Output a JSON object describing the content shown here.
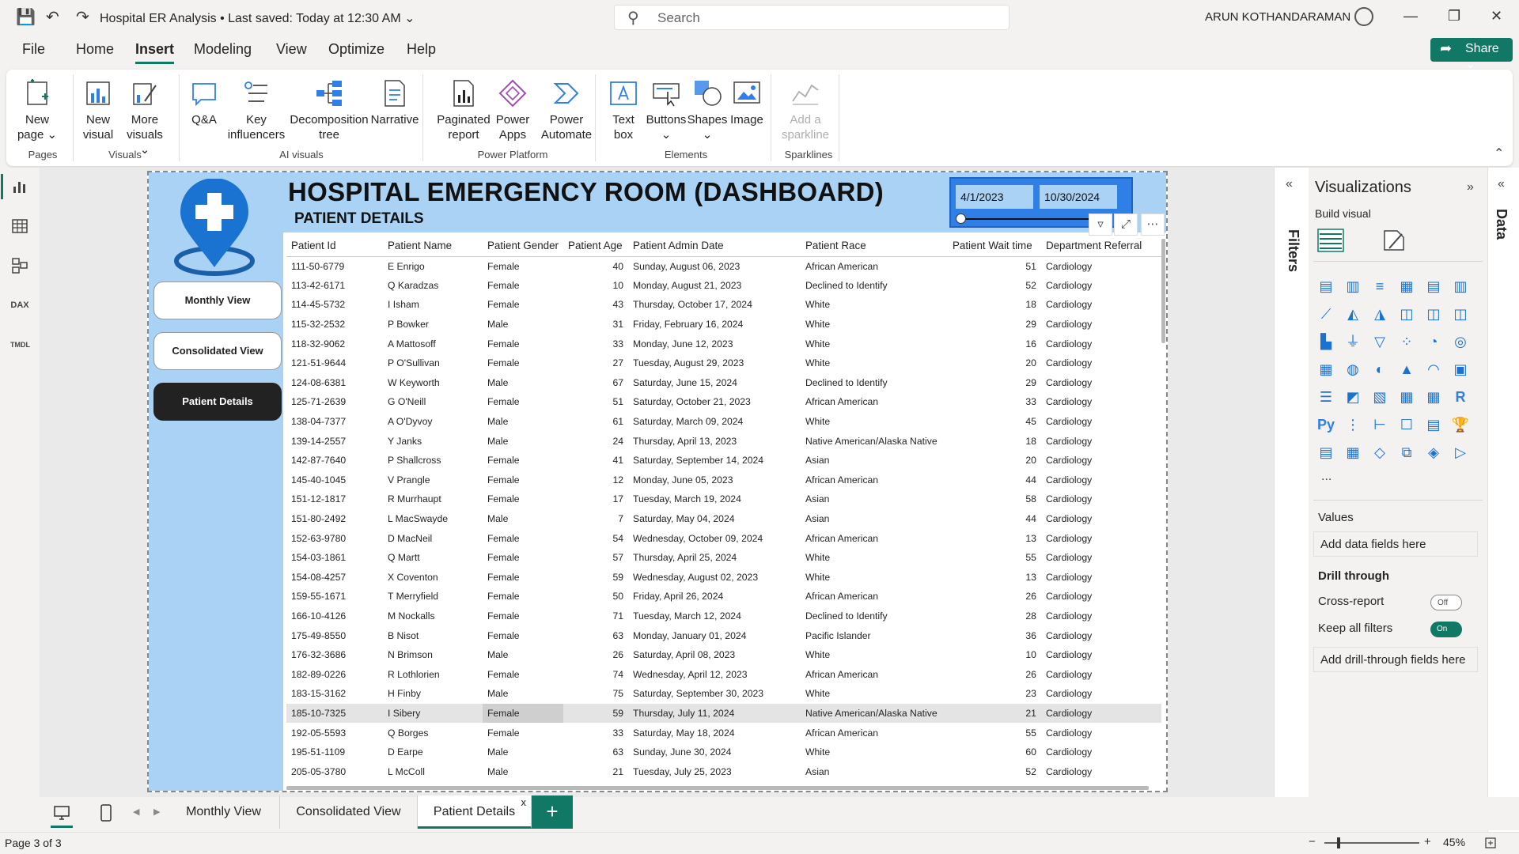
{
  "app": {
    "doc_title": "Hospital ER Analysis",
    "save_status": "Last saved: Today at 12:30 AM",
    "search_placeholder": "Search",
    "user_name": "ARUN KOTHANDARAMAN"
  },
  "menu": [
    "File",
    "Home",
    "Insert",
    "Modeling",
    "View",
    "Optimize",
    "Help"
  ],
  "share_label": "Share",
  "ribbon": {
    "buttons": [
      {
        "l1": "New",
        "l2": "page ⌄"
      },
      {
        "l1": "New",
        "l2": "visual"
      },
      {
        "l1": "More",
        "l2": "visuals ⌄"
      },
      {
        "l1": "Q&A",
        "l2": ""
      },
      {
        "l1": "Key",
        "l2": "influencers"
      },
      {
        "l1": "Decomposition",
        "l2": "tree"
      },
      {
        "l1": "Narrative",
        "l2": ""
      },
      {
        "l1": "Paginated",
        "l2": "report"
      },
      {
        "l1": "Power",
        "l2": "Apps"
      },
      {
        "l1": "Power",
        "l2": "Automate"
      },
      {
        "l1": "Text",
        "l2": "box"
      },
      {
        "l1": "Buttons",
        "l2": "⌄"
      },
      {
        "l1": "Shapes",
        "l2": "⌄"
      },
      {
        "l1": "Image",
        "l2": ""
      },
      {
        "l1": "Add a",
        "l2": "sparkline"
      }
    ],
    "groups": [
      "Pages",
      "Visuals",
      "AI visuals",
      "Power Platform",
      "Elements",
      "Sparklines"
    ]
  },
  "left_nav": [
    "report-view-icon",
    "table-view-icon",
    "model-view-icon",
    "DAX",
    "TMDL"
  ],
  "dashboard": {
    "title": "HOSPITAL EMERGENCY ROOM (DASHBOARD)",
    "subtitle": "PATIENT DETAILS",
    "date_start": "4/1/2023",
    "date_end": "10/30/2024",
    "nav_buttons": [
      "Monthly View",
      "Consolidated View",
      "Patient Details"
    ]
  },
  "table": {
    "headers": [
      "Patient Id",
      "Patient Name",
      "Patient Gender",
      "Patient Age",
      "Patient Admin Date",
      "Patient Race",
      "Patient Wait time",
      "Department Referral"
    ],
    "rows": [
      [
        "111-50-6779",
        "E Enrigo",
        "Female",
        "40",
        "Sunday, August 06, 2023",
        "African American",
        "51",
        "Cardiology"
      ],
      [
        "113-42-6171",
        "Q Karadzas",
        "Female",
        "10",
        "Monday, August 21, 2023",
        "Declined to Identify",
        "52",
        "Cardiology"
      ],
      [
        "114-45-5732",
        "I Isham",
        "Female",
        "43",
        "Thursday, October 17, 2024",
        "White",
        "18",
        "Cardiology"
      ],
      [
        "115-32-2532",
        "P Bowker",
        "Male",
        "31",
        "Friday, February 16, 2024",
        "White",
        "29",
        "Cardiology"
      ],
      [
        "118-32-9062",
        "A Mattosoff",
        "Female",
        "33",
        "Monday, June 12, 2023",
        "White",
        "16",
        "Cardiology"
      ],
      [
        "121-51-9644",
        "P O'Sullivan",
        "Female",
        "27",
        "Tuesday, August 29, 2023",
        "White",
        "20",
        "Cardiology"
      ],
      [
        "124-08-6381",
        "W Keyworth",
        "Male",
        "67",
        "Saturday, June 15, 2024",
        "Declined to Identify",
        "29",
        "Cardiology"
      ],
      [
        "125-71-2639",
        "G O'Neill",
        "Female",
        "51",
        "Saturday, October 21, 2023",
        "African American",
        "33",
        "Cardiology"
      ],
      [
        "138-04-7377",
        "A O'Dyvoy",
        "Male",
        "61",
        "Saturday, March 09, 2024",
        "White",
        "45",
        "Cardiology"
      ],
      [
        "139-14-2557",
        "Y Janks",
        "Male",
        "24",
        "Thursday, April 13, 2023",
        "Native American/Alaska Native",
        "18",
        "Cardiology"
      ],
      [
        "142-87-7640",
        "P Shallcross",
        "Female",
        "41",
        "Saturday, September 14, 2024",
        "Asian",
        "20",
        "Cardiology"
      ],
      [
        "145-40-1045",
        "V Prangle",
        "Female",
        "12",
        "Monday, June 05, 2023",
        "African American",
        "44",
        "Cardiology"
      ],
      [
        "151-12-1817",
        "R Murrhaupt",
        "Female",
        "17",
        "Tuesday, March 19, 2024",
        "Asian",
        "58",
        "Cardiology"
      ],
      [
        "151-80-2492",
        "L MacSwayde",
        "Male",
        "7",
        "Saturday, May 04, 2024",
        "Asian",
        "44",
        "Cardiology"
      ],
      [
        "152-63-9780",
        "D MacNeil",
        "Female",
        "54",
        "Wednesday, October 09, 2024",
        "African American",
        "13",
        "Cardiology"
      ],
      [
        "154-03-1861",
        "Q Martt",
        "Female",
        "57",
        "Thursday, April 25, 2024",
        "White",
        "55",
        "Cardiology"
      ],
      [
        "154-08-4257",
        "X Coventon",
        "Female",
        "59",
        "Wednesday, August 02, 2023",
        "White",
        "13",
        "Cardiology"
      ],
      [
        "159-55-1671",
        "T Merryfield",
        "Female",
        "50",
        "Friday, April 26, 2024",
        "African American",
        "26",
        "Cardiology"
      ],
      [
        "166-10-4126",
        "M Nockalls",
        "Female",
        "71",
        "Tuesday, March 12, 2024",
        "Declined to Identify",
        "28",
        "Cardiology"
      ],
      [
        "175-49-8550",
        "B Nisot",
        "Female",
        "63",
        "Monday, January 01, 2024",
        "Pacific Islander",
        "36",
        "Cardiology"
      ],
      [
        "176-32-3686",
        "N Brimson",
        "Male",
        "26",
        "Saturday, April 08, 2023",
        "White",
        "10",
        "Cardiology"
      ],
      [
        "182-89-0226",
        "R Lothlorien",
        "Female",
        "74",
        "Wednesday, April 12, 2023",
        "African American",
        "26",
        "Cardiology"
      ],
      [
        "183-15-3162",
        "H Finby",
        "Male",
        "75",
        "Saturday, September 30, 2023",
        "White",
        "23",
        "Cardiology"
      ],
      [
        "185-10-7325",
        "I Sibery",
        "Female",
        "59",
        "Thursday, July 11, 2024",
        "Native American/Alaska Native",
        "21",
        "Cardiology"
      ],
      [
        "192-05-5593",
        "Q Borges",
        "Female",
        "33",
        "Saturday, May 18, 2024",
        "African American",
        "55",
        "Cardiology"
      ],
      [
        "195-51-1109",
        "D Earpe",
        "Male",
        "63",
        "Sunday, June 30, 2024",
        "White",
        "60",
        "Cardiology"
      ],
      [
        "205-05-3780",
        "L McColl",
        "Male",
        "21",
        "Tuesday, July 25, 2023",
        "Asian",
        "52",
        "Cardiology"
      ]
    ]
  },
  "filters_label": "Filters",
  "viz": {
    "title": "Visualizations",
    "build_visual": "Build visual",
    "values_label": "Values",
    "add_data_fields": "Add data fields here",
    "drill_through": "Drill through",
    "cross_report": "Cross-report",
    "cross_report_state": "Off",
    "keep_filters": "Keep all filters",
    "keep_filters_state": "On",
    "add_drill": "Add drill-through fields here",
    "more": "..."
  },
  "data_label": "Data",
  "tabs": [
    "Monthly View",
    "Consolidated View",
    "Patient Details"
  ],
  "tab_close": "x",
  "add_tab": "+",
  "status": {
    "page": "Page 3 of 3",
    "zoom": "45%"
  },
  "colors": {
    "accent": "#117865",
    "panel_blue": "#a9d2f5",
    "slicer_blue": "#2f7fe6"
  }
}
